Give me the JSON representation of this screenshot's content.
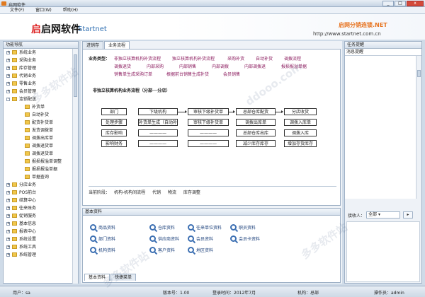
{
  "window": {
    "title": "启网软件"
  },
  "menu": [
    "文件(F)",
    "窗口(W)",
    "帮助(H)"
  ],
  "banner": {
    "brand_cn": "启网软件",
    "brand_en": "Startnet",
    "slogan": "启网分销连锁.NET",
    "url": "http://www.startnet.com.cn"
  },
  "nav": {
    "title": "功能导航",
    "items": [
      {
        "label": "系统业务",
        "level": 0,
        "expanded": false
      },
      {
        "label": "采购业务",
        "level": 0,
        "expanded": false
      },
      {
        "label": "库存管理",
        "level": 0,
        "expanded": false
      },
      {
        "label": "代销业务",
        "level": 0,
        "expanded": false
      },
      {
        "label": "零售业务",
        "level": 0,
        "expanded": false
      },
      {
        "label": "会员管理",
        "level": 0,
        "expanded": false
      },
      {
        "label": "连锁配送",
        "level": 0,
        "expanded": true
      },
      {
        "label": "补货单",
        "level": 1
      },
      {
        "label": "自动补货",
        "level": 1
      },
      {
        "label": "配货补货单",
        "level": 1
      },
      {
        "label": "发货调拨单",
        "level": 1
      },
      {
        "label": "调拨出库单",
        "level": 1
      },
      {
        "label": "调拨退货单",
        "level": 1
      },
      {
        "label": "调拨退货单",
        "level": 1
      },
      {
        "label": "报损报溢单调整",
        "level": 1
      },
      {
        "label": "报损报溢单据",
        "level": 1
      },
      {
        "label": "单据查询",
        "level": 1
      },
      {
        "label": "分店业务",
        "level": 0,
        "expanded": false
      },
      {
        "label": "POS前台",
        "level": 0,
        "expanded": false
      },
      {
        "label": "结算中心",
        "level": 0,
        "expanded": false
      },
      {
        "label": "往来账务",
        "level": 0,
        "expanded": false
      },
      {
        "label": "促销服务",
        "level": 0,
        "expanded": false
      },
      {
        "label": "基本信息",
        "level": 0,
        "expanded": false
      },
      {
        "label": "报表中心",
        "level": 0,
        "expanded": false
      },
      {
        "label": "系统设置",
        "level": 0,
        "expanded": false
      },
      {
        "label": "系统工具",
        "level": 0,
        "expanded": false
      },
      {
        "label": "系统管理",
        "level": 0,
        "expanded": false
      }
    ]
  },
  "tabs": [
    "进销存",
    "业务流程"
  ],
  "workflow": {
    "category_label": "业务类型：",
    "categories": [
      [
        "非独立核算机构补货流程",
        "独立核算机构补货流程",
        "采购补货",
        "自动补货",
        "调拨流程"
      ],
      [
        "调拨退货",
        "内部采购",
        "内部销售",
        "内部调拨",
        "内部调拨退",
        "报损报溢单据"
      ],
      [
        "销售单生成采购订单",
        "根据前台销售生成补货",
        "会员销售"
      ]
    ],
    "flow_title": "非独立核算机构业务流程（分部──分店）",
    "rows": [
      {
        "head": "部门",
        "cells": [
          "下级机构",
          "审核下级补货单",
          "总部仓库配货",
          "分店收货"
        ]
      },
      {
        "head": "处理步骤",
        "cells": [
          "补货单生成（自动补货）",
          "审核下级补货单",
          "调拨出库单",
          "调拨入库单"
        ]
      },
      {
        "head": "库存影响",
        "cells": [
          "————",
          "————",
          "总部仓库出库",
          "调拨入库"
        ]
      },
      {
        "head": "影响财务",
        "cells": [
          "————",
          "————",
          "减少库存库存",
          "增加存货库存"
        ]
      }
    ],
    "stage_label": "当前阶段：",
    "stages": [
      "机构-机构间流程",
      "代销",
      "物流",
      "库存调整"
    ]
  },
  "info": {
    "title": "基本资料",
    "items": [
      "商品资料",
      "仓库资料",
      "往来单位资料",
      "职员资料",
      "部门资料",
      "供应商资料",
      "会员资料",
      "会员卡资料",
      "机构资料",
      "客户资料",
      "地区资料"
    ],
    "tabs": [
      "基本资料",
      "快捷菜单"
    ]
  },
  "right": {
    "title": "任务提醒",
    "box_header": "消息提醒",
    "filter_label": "接收人：",
    "filter_value": "全部"
  },
  "status": {
    "user": "用户：sa",
    "org": "机构：总部",
    "time": "登录时间：2012年7月",
    "version": "版本号：1.00",
    "operator": "操作员：admin"
  }
}
